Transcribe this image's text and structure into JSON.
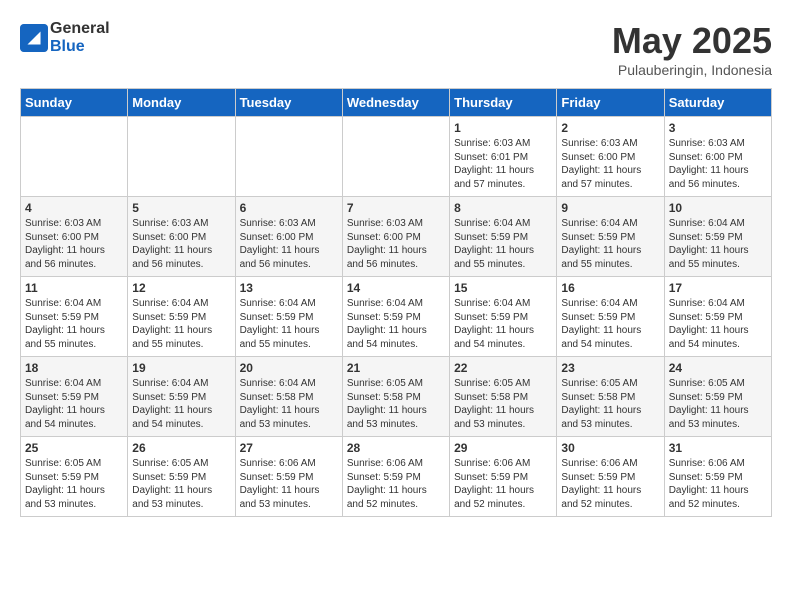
{
  "logo": {
    "text_general": "General",
    "text_blue": "Blue"
  },
  "title": "May 2025",
  "subtitle": "Pulauberingin, Indonesia",
  "weekdays": [
    "Sunday",
    "Monday",
    "Tuesday",
    "Wednesday",
    "Thursday",
    "Friday",
    "Saturday"
  ],
  "weeks": [
    [
      {
        "day": "",
        "sunrise": "",
        "sunset": "",
        "daylight": ""
      },
      {
        "day": "",
        "sunrise": "",
        "sunset": "",
        "daylight": ""
      },
      {
        "day": "",
        "sunrise": "",
        "sunset": "",
        "daylight": ""
      },
      {
        "day": "",
        "sunrise": "",
        "sunset": "",
        "daylight": ""
      },
      {
        "day": "1",
        "sunrise": "Sunrise: 6:03 AM",
        "sunset": "Sunset: 6:01 PM",
        "daylight": "Daylight: 11 hours and 57 minutes."
      },
      {
        "day": "2",
        "sunrise": "Sunrise: 6:03 AM",
        "sunset": "Sunset: 6:00 PM",
        "daylight": "Daylight: 11 hours and 57 minutes."
      },
      {
        "day": "3",
        "sunrise": "Sunrise: 6:03 AM",
        "sunset": "Sunset: 6:00 PM",
        "daylight": "Daylight: 11 hours and 56 minutes."
      }
    ],
    [
      {
        "day": "4",
        "sunrise": "Sunrise: 6:03 AM",
        "sunset": "Sunset: 6:00 PM",
        "daylight": "Daylight: 11 hours and 56 minutes."
      },
      {
        "day": "5",
        "sunrise": "Sunrise: 6:03 AM",
        "sunset": "Sunset: 6:00 PM",
        "daylight": "Daylight: 11 hours and 56 minutes."
      },
      {
        "day": "6",
        "sunrise": "Sunrise: 6:03 AM",
        "sunset": "Sunset: 6:00 PM",
        "daylight": "Daylight: 11 hours and 56 minutes."
      },
      {
        "day": "7",
        "sunrise": "Sunrise: 6:03 AM",
        "sunset": "Sunset: 6:00 PM",
        "daylight": "Daylight: 11 hours and 56 minutes."
      },
      {
        "day": "8",
        "sunrise": "Sunrise: 6:04 AM",
        "sunset": "Sunset: 5:59 PM",
        "daylight": "Daylight: 11 hours and 55 minutes."
      },
      {
        "day": "9",
        "sunrise": "Sunrise: 6:04 AM",
        "sunset": "Sunset: 5:59 PM",
        "daylight": "Daylight: 11 hours and 55 minutes."
      },
      {
        "day": "10",
        "sunrise": "Sunrise: 6:04 AM",
        "sunset": "Sunset: 5:59 PM",
        "daylight": "Daylight: 11 hours and 55 minutes."
      }
    ],
    [
      {
        "day": "11",
        "sunrise": "Sunrise: 6:04 AM",
        "sunset": "Sunset: 5:59 PM",
        "daylight": "Daylight: 11 hours and 55 minutes."
      },
      {
        "day": "12",
        "sunrise": "Sunrise: 6:04 AM",
        "sunset": "Sunset: 5:59 PM",
        "daylight": "Daylight: 11 hours and 55 minutes."
      },
      {
        "day": "13",
        "sunrise": "Sunrise: 6:04 AM",
        "sunset": "Sunset: 5:59 PM",
        "daylight": "Daylight: 11 hours and 55 minutes."
      },
      {
        "day": "14",
        "sunrise": "Sunrise: 6:04 AM",
        "sunset": "Sunset: 5:59 PM",
        "daylight": "Daylight: 11 hours and 54 minutes."
      },
      {
        "day": "15",
        "sunrise": "Sunrise: 6:04 AM",
        "sunset": "Sunset: 5:59 PM",
        "daylight": "Daylight: 11 hours and 54 minutes."
      },
      {
        "day": "16",
        "sunrise": "Sunrise: 6:04 AM",
        "sunset": "Sunset: 5:59 PM",
        "daylight": "Daylight: 11 hours and 54 minutes."
      },
      {
        "day": "17",
        "sunrise": "Sunrise: 6:04 AM",
        "sunset": "Sunset: 5:59 PM",
        "daylight": "Daylight: 11 hours and 54 minutes."
      }
    ],
    [
      {
        "day": "18",
        "sunrise": "Sunrise: 6:04 AM",
        "sunset": "Sunset: 5:59 PM",
        "daylight": "Daylight: 11 hours and 54 minutes."
      },
      {
        "day": "19",
        "sunrise": "Sunrise: 6:04 AM",
        "sunset": "Sunset: 5:59 PM",
        "daylight": "Daylight: 11 hours and 54 minutes."
      },
      {
        "day": "20",
        "sunrise": "Sunrise: 6:04 AM",
        "sunset": "Sunset: 5:58 PM",
        "daylight": "Daylight: 11 hours and 53 minutes."
      },
      {
        "day": "21",
        "sunrise": "Sunrise: 6:05 AM",
        "sunset": "Sunset: 5:58 PM",
        "daylight": "Daylight: 11 hours and 53 minutes."
      },
      {
        "day": "22",
        "sunrise": "Sunrise: 6:05 AM",
        "sunset": "Sunset: 5:58 PM",
        "daylight": "Daylight: 11 hours and 53 minutes."
      },
      {
        "day": "23",
        "sunrise": "Sunrise: 6:05 AM",
        "sunset": "Sunset: 5:58 PM",
        "daylight": "Daylight: 11 hours and 53 minutes."
      },
      {
        "day": "24",
        "sunrise": "Sunrise: 6:05 AM",
        "sunset": "Sunset: 5:59 PM",
        "daylight": "Daylight: 11 hours and 53 minutes."
      }
    ],
    [
      {
        "day": "25",
        "sunrise": "Sunrise: 6:05 AM",
        "sunset": "Sunset: 5:59 PM",
        "daylight": "Daylight: 11 hours and 53 minutes."
      },
      {
        "day": "26",
        "sunrise": "Sunrise: 6:05 AM",
        "sunset": "Sunset: 5:59 PM",
        "daylight": "Daylight: 11 hours and 53 minutes."
      },
      {
        "day": "27",
        "sunrise": "Sunrise: 6:06 AM",
        "sunset": "Sunset: 5:59 PM",
        "daylight": "Daylight: 11 hours and 53 minutes."
      },
      {
        "day": "28",
        "sunrise": "Sunrise: 6:06 AM",
        "sunset": "Sunset: 5:59 PM",
        "daylight": "Daylight: 11 hours and 52 minutes."
      },
      {
        "day": "29",
        "sunrise": "Sunrise: 6:06 AM",
        "sunset": "Sunset: 5:59 PM",
        "daylight": "Daylight: 11 hours and 52 minutes."
      },
      {
        "day": "30",
        "sunrise": "Sunrise: 6:06 AM",
        "sunset": "Sunset: 5:59 PM",
        "daylight": "Daylight: 11 hours and 52 minutes."
      },
      {
        "day": "31",
        "sunrise": "Sunrise: 6:06 AM",
        "sunset": "Sunset: 5:59 PM",
        "daylight": "Daylight: 11 hours and 52 minutes."
      }
    ]
  ]
}
